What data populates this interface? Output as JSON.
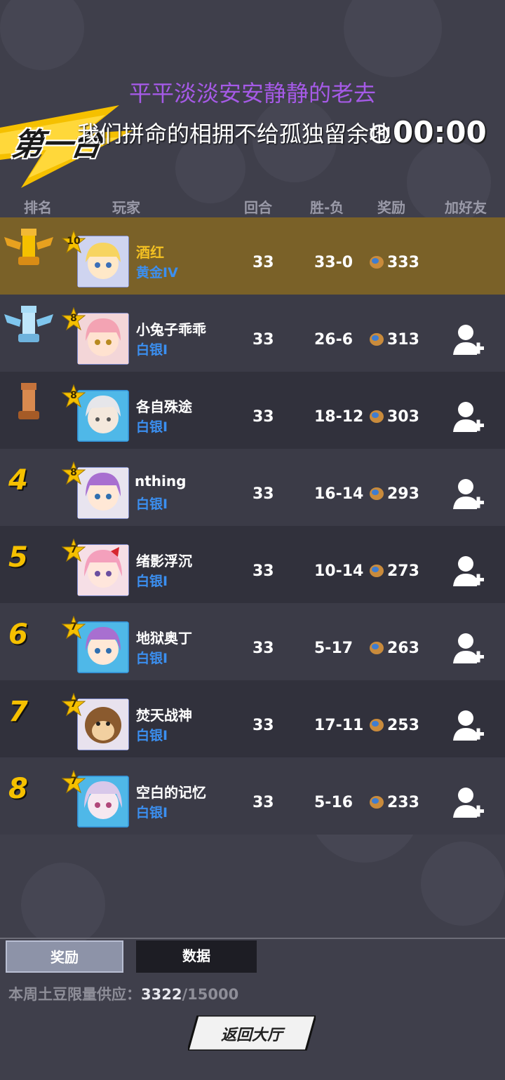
{
  "header": {
    "round_banner": "第一台",
    "lyric_line1": "平平淡淡安安静静的老去",
    "lyric_line2": "我们拼命的相拥不给孤独留余地",
    "timer": "00:00",
    "clock_icon": "clock-icon"
  },
  "columns": {
    "rank": "排名",
    "player": "玩家",
    "rounds": "回合",
    "win_loss": "胜-负",
    "reward": "奖励",
    "add_friend": "加好友"
  },
  "rows": [
    {
      "rank": "1",
      "level": "10",
      "name": "酒红",
      "tier": "黄金IV",
      "rounds": "33",
      "wl": "33-0",
      "reward": "333",
      "add_friend": false
    },
    {
      "rank": "2",
      "level": "8",
      "name": "小兔子乖乖",
      "tier": "白银I",
      "rounds": "33",
      "wl": "26-6",
      "reward": "313",
      "add_friend": true
    },
    {
      "rank": "3",
      "level": "8",
      "name": "各自殊途",
      "tier": "白银I",
      "rounds": "33",
      "wl": "18-12",
      "reward": "303",
      "add_friend": true
    },
    {
      "rank": "4",
      "level": "8",
      "name": "nthing",
      "tier": "白银I",
      "rounds": "33",
      "wl": "16-14",
      "reward": "293",
      "add_friend": true
    },
    {
      "rank": "5",
      "level": "7",
      "name": "绪影浮沉",
      "tier": "白银I",
      "rounds": "33",
      "wl": "10-14",
      "reward": "273",
      "add_friend": true
    },
    {
      "rank": "6",
      "level": "7",
      "name": "地狱奥丁",
      "tier": "白银I",
      "rounds": "33",
      "wl": "5-17",
      "reward": "263",
      "add_friend": true
    },
    {
      "rank": "7",
      "level": "7",
      "name": "焚天战神",
      "tier": "白银I",
      "rounds": "33",
      "wl": "17-11",
      "reward": "253",
      "add_friend": true
    },
    {
      "rank": "8",
      "level": "7",
      "name": "空白的记忆",
      "tier": "白银I",
      "rounds": "33",
      "wl": "5-16",
      "reward": "233",
      "add_friend": true
    }
  ],
  "tabs": {
    "reward": "奖励",
    "data": "数据"
  },
  "supply": {
    "label": "本周土豆限量供应：",
    "current": "3322",
    "total": "/15000"
  },
  "back_button": "返回大厅",
  "colors": {
    "gold_row": "#7a6128",
    "rank_number": "#f5c000",
    "tier_blue": "#3b8ff0",
    "lyric_purple": "#a55ae6"
  }
}
